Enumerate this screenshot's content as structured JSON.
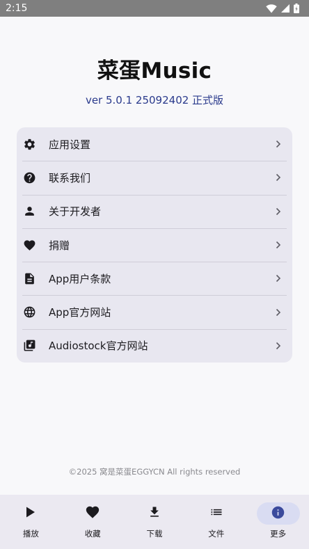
{
  "status_bar": {
    "time": "2:15",
    "icons": [
      "wifi-icon",
      "signal-icon",
      "battery-icon"
    ]
  },
  "header": {
    "title": "菜蛋Music",
    "version": "ver 5.0.1 25092402 正式版"
  },
  "menu": {
    "items": [
      {
        "label": "应用设置",
        "icon": "gear-icon"
      },
      {
        "label": "联系我们",
        "icon": "help-icon"
      },
      {
        "label": "关于开发者",
        "icon": "person-icon"
      },
      {
        "label": "捐赠",
        "icon": "heart-icon"
      },
      {
        "label": "App用户条款",
        "icon": "document-icon"
      },
      {
        "label": "App官方网站",
        "icon": "globe-icon"
      },
      {
        "label": "Audiostock官方网站",
        "icon": "music-library-icon"
      }
    ]
  },
  "footer": {
    "copyright": "©2025 窝是菜蛋EGGYCN All rights reserved"
  },
  "bottom_nav": {
    "items": [
      {
        "label": "播放",
        "icon": "play-icon",
        "active": false
      },
      {
        "label": "收藏",
        "icon": "heart-icon",
        "active": false
      },
      {
        "label": "下载",
        "icon": "download-icon",
        "active": false
      },
      {
        "label": "文件",
        "icon": "list-icon",
        "active": false
      },
      {
        "label": "更多",
        "icon": "info-icon",
        "active": true
      }
    ]
  },
  "colors": {
    "status_bar": "#7f7f7f",
    "version_text": "#2a3a8c",
    "card_background": "#e8e7f0",
    "nav_background": "#ebe9f1",
    "active_pill": "#d9dcf2",
    "active_icon": "#3b4a9c"
  }
}
